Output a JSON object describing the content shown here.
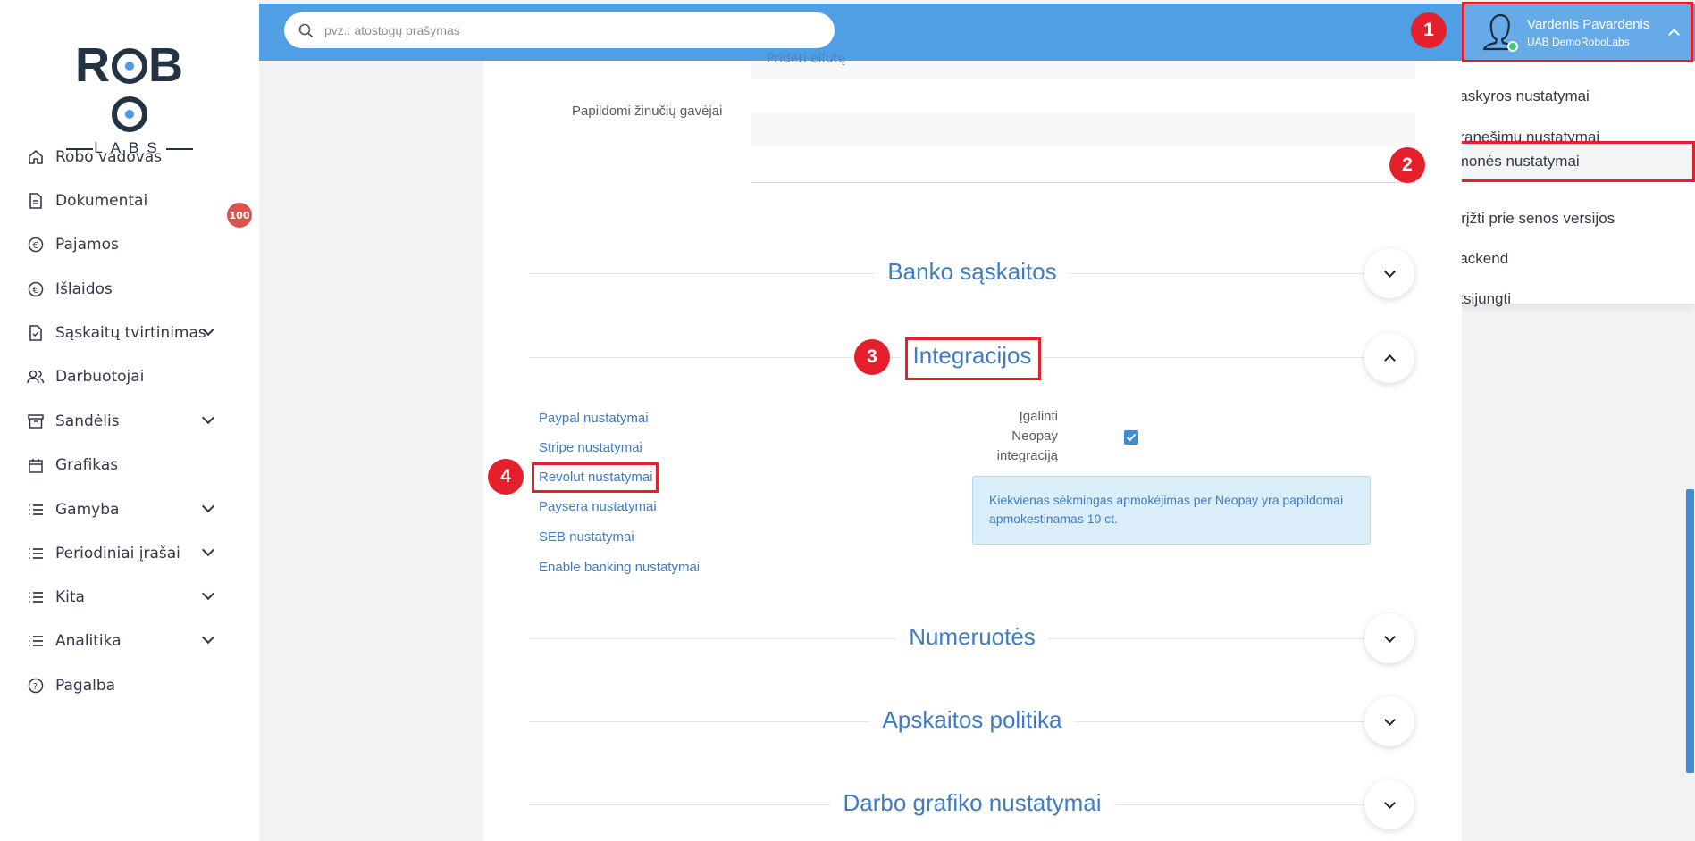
{
  "brand": {
    "logo_top": "ROBO",
    "logo_bottom": "LABS"
  },
  "sidebar": {
    "items": [
      {
        "label": "Robo vadovas",
        "icon": "home-icon"
      },
      {
        "label": "Dokumentai",
        "icon": "document-icon",
        "badge": "100"
      },
      {
        "label": "Pajamos",
        "icon": "euro-icon"
      },
      {
        "label": "Išlaidos",
        "icon": "euro-icon"
      },
      {
        "label": "Sąskaitų tvirtinimas",
        "icon": "file-check-icon",
        "expandable": true
      },
      {
        "label": "Darbuotojai",
        "icon": "users-icon"
      },
      {
        "label": "Sandėlis",
        "icon": "archive-icon",
        "expandable": true
      },
      {
        "label": "Grafikas",
        "icon": "calendar-icon"
      },
      {
        "label": "Gamyba",
        "icon": "list-icon",
        "expandable": true
      },
      {
        "label": "Periodiniai įrašai",
        "icon": "list-icon",
        "expandable": true
      },
      {
        "label": "Kita",
        "icon": "list-icon",
        "expandable": true
      },
      {
        "label": "Analitika",
        "icon": "list-icon",
        "expandable": true
      },
      {
        "label": "Pagalba",
        "icon": "help-icon"
      }
    ]
  },
  "search": {
    "placeholder": "pvz.: atostogų prašymas"
  },
  "user": {
    "name": "Vardenis Pavardenis",
    "company": "UAB DemoRoboLabs",
    "status_color": "#3ecb6c"
  },
  "dropdown": {
    "items": [
      {
        "label": "Paskyros nustatymai"
      },
      {
        "label": "Pranešimų nustatymai"
      },
      {
        "label": "Įmonės nustatymai",
        "highlighted": true
      },
      {
        "label": "Grįžti prie senos versijos"
      },
      {
        "label": "Backend"
      },
      {
        "label": "Atsijungti"
      }
    ]
  },
  "form": {
    "top_field_text": "Pridėti eilutę",
    "recipients_label": "Papildomi žinučių gavėjai"
  },
  "sections": {
    "bank": "Banko sąskaitos",
    "integrations": "Integracijos",
    "numbering": "Numeruotės",
    "accounting": "Apskaitos politika",
    "schedule": "Darbo grafiko nustatymai"
  },
  "integrations": {
    "links": [
      "Paypal nustatymai",
      "Stripe nustatymai",
      "Revolut nustatymai",
      "Paysera nustatymai",
      "SEB nustatymai",
      "Enable banking nustatymai"
    ],
    "neopay_label": [
      "Įgalinti",
      "Neopay",
      "integraciją"
    ],
    "neopay_enabled": true,
    "info_text": "Kiekvienas sėkmingas apmokėjimas per Neopay yra papildomai apmokestinamas 10 ct."
  },
  "markers": [
    "1",
    "2",
    "3",
    "4"
  ],
  "colors": {
    "accent": "#509ee3",
    "highlight": "#e3202b",
    "link": "#3f7cc2",
    "badge": "#d9534f"
  }
}
